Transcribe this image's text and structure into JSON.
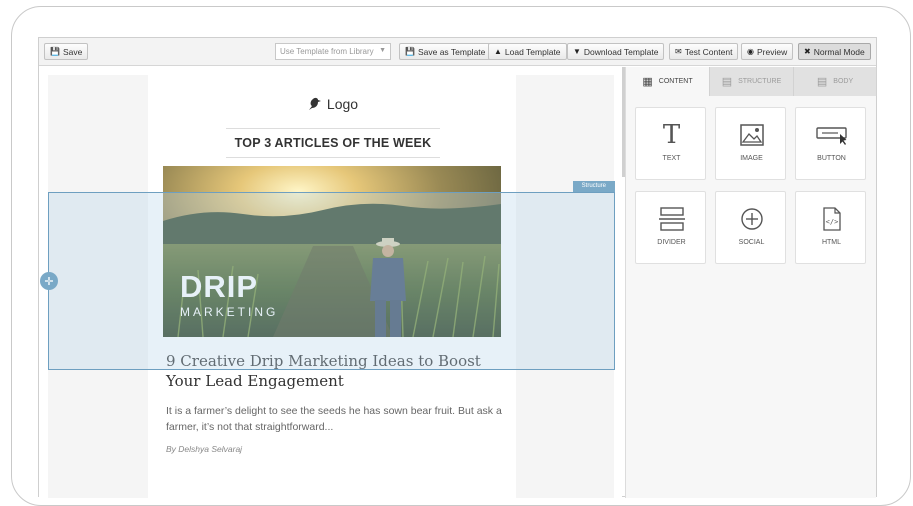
{
  "toolbar": {
    "save_label": "Save",
    "template_select_placeholder": "Use Template from Library",
    "save_as_template_label": "Save as Template",
    "load_template_label": "Load Template",
    "download_template_label": "Download Template",
    "test_content_label": "Test Content",
    "preview_label": "Preview",
    "normal_mode_label": "Normal Mode"
  },
  "email": {
    "logo_text": "Logo",
    "headline": "TOP 3 ARTICLES OF THE WEEK",
    "hero_title": "DRIP",
    "hero_subtitle": "MARKETING",
    "article_title": "9 Creative Drip Marketing Ideas to Boost Your Lead Engagement",
    "article_body": "It is a farmer’s delight to see the seeds he has sown bear fruit. But ask a farmer, it’s not that straightforward...",
    "article_author": "By Delshya Selvaraj",
    "selection_label": "Structure"
  },
  "panel": {
    "tabs": [
      {
        "label": "CONTENT",
        "icon": "grid-icon",
        "active": true
      },
      {
        "label": "STRUCTURE",
        "icon": "rows-icon",
        "active": false
      },
      {
        "label": "BODY",
        "icon": "body-icon",
        "active": false
      }
    ],
    "blocks": [
      {
        "label": "TEXT",
        "icon": "text-icon"
      },
      {
        "label": "IMAGE",
        "icon": "image-icon"
      },
      {
        "label": "BUTTON",
        "icon": "button-icon"
      },
      {
        "label": "DIVIDER",
        "icon": "divider-icon"
      },
      {
        "label": "SOCIAL",
        "icon": "social-icon"
      },
      {
        "label": "HTML",
        "icon": "html-icon"
      }
    ]
  },
  "colors": {
    "selection": "#7aa9c7",
    "toolbar_bg": "#f3f3f3",
    "panel_bg": "#f7f7f7"
  }
}
